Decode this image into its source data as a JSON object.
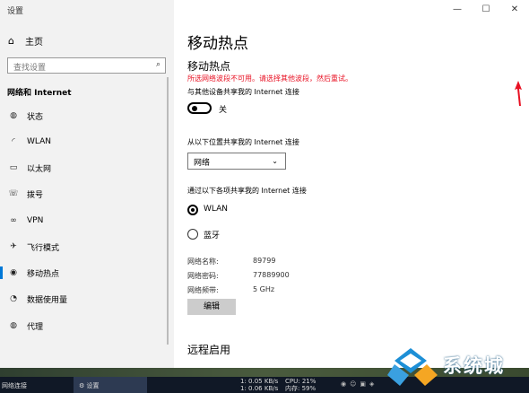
{
  "window": {
    "title": "设置",
    "minimize_icon": "minimize-icon",
    "maximize_icon": "maximize-icon",
    "close_icon": "close-icon"
  },
  "sidebar": {
    "home": {
      "icon": "home-icon",
      "label": "主页"
    },
    "search_placeholder": "查找设置",
    "section_title": "网络和 Internet",
    "items": [
      {
        "icon": "globe-icon",
        "label": "状态"
      },
      {
        "icon": "wifi-icon",
        "label": "WLAN"
      },
      {
        "icon": "ethernet-icon",
        "label": "以太网"
      },
      {
        "icon": "phone-dial-icon",
        "label": "拨号"
      },
      {
        "icon": "vpn-icon",
        "label": "VPN"
      },
      {
        "icon": "airplane-icon",
        "label": "飞行模式"
      },
      {
        "icon": "hotspot-icon",
        "label": "移动热点"
      },
      {
        "icon": "data-usage-icon",
        "label": "数据使用量"
      },
      {
        "icon": "globe-icon",
        "label": "代理"
      }
    ]
  },
  "main": {
    "page_title": "移动热点",
    "section_title": "移动热点",
    "error_text": "所选网络波段不可用。请选择其他波段，然后重试。",
    "share_label": "与其他设备共享我的 Internet 连接",
    "toggle_state": "关",
    "share_from_label": "从以下位置共享我的 Internet 连接",
    "share_from_value": "网络",
    "share_over_label": "通过以下各项共享我的 Internet 连接",
    "option_wlan": "WLAN",
    "option_bluetooth": "蓝牙",
    "selected_option": "WLAN",
    "network_name_label": "网络名称:",
    "network_name": "89799",
    "password_label": "网络密码:",
    "password": "77889900",
    "band_label": "网络频带:",
    "band": "5 GHz",
    "edit_button": "编辑",
    "remote_title": "远程启用"
  },
  "taskbar": {
    "network_item": "网络连接",
    "settings_item": "设置",
    "upload": "1: 0.05 KB/s",
    "download": "1: 0.06 KB/s",
    "cpu": "CPU: 21%",
    "memory": "内存: 59%",
    "watermark": "系统城"
  },
  "colors": {
    "accent": "#0078d7",
    "error": "#e81123",
    "sidebar_bg": "#f2f2f2",
    "arrow": "#e81123"
  }
}
